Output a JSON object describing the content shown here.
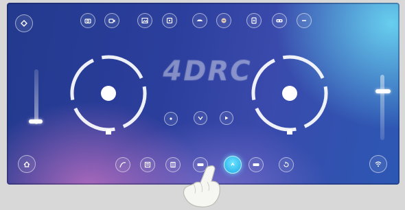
{
  "app": {
    "logo_text": "4DRC",
    "accent_color": "#1aa8e6",
    "screen_colors": {
      "deep_blue": "#233a8e",
      "pink_glow": "#d678c8",
      "cyan_glow": "#6edcf5"
    }
  },
  "top_toolbar": {
    "left_corner_icon": "settings-icon",
    "items": [
      {
        "icon": "camera-icon"
      },
      {
        "icon": "video-icon"
      },
      {
        "icon": "gallery-icon"
      },
      {
        "icon": "headless-mode-icon"
      },
      {
        "icon": "drone-icon"
      },
      {
        "icon": "gesture-icon"
      },
      {
        "icon": "gravity-sensor-icon"
      },
      {
        "icon": "vr-icon"
      },
      {
        "icon": "more-icon"
      }
    ]
  },
  "center_controls": [
    {
      "icon": "one-key-takeoff-icon"
    },
    {
      "icon": "one-key-land-icon"
    },
    {
      "icon": "emergency-stop-icon"
    }
  ],
  "bottom_toolbar": {
    "left_corner_icon": "home-icon",
    "right_corner_icon": "wifi-icon",
    "items": [
      {
        "icon": "trajectory-icon"
      },
      {
        "icon": "album-icon"
      },
      {
        "icon": "flip-icon"
      },
      {
        "icon": "speed-icon"
      },
      {
        "icon": "altitude-hold-icon",
        "active": true
      },
      {
        "icon": "calibrate-icon"
      },
      {
        "icon": "return-icon"
      }
    ]
  },
  "joysticks": {
    "left": {
      "label": ""
    },
    "right": {
      "label": ""
    }
  },
  "trims": {
    "left_vertical_level": 0.85,
    "right_vertical_level": 0.3
  }
}
